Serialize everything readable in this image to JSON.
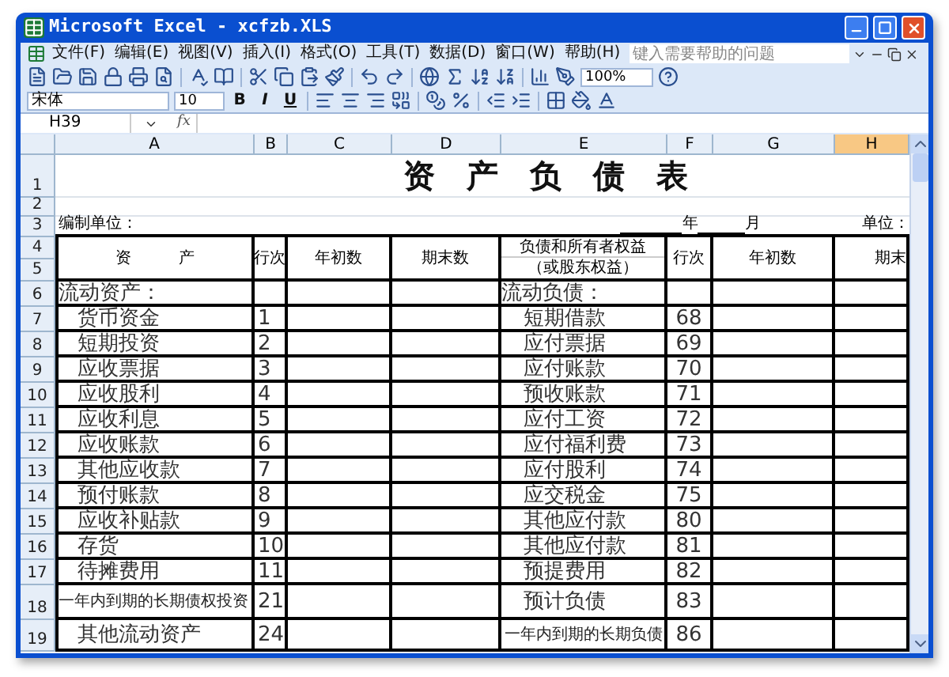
{
  "window": {
    "title": "Microsoft Excel - xcfzb.XLS"
  },
  "menu": [
    {
      "label": "文件(F)"
    },
    {
      "label": "编辑(E)"
    },
    {
      "label": "视图(V)"
    },
    {
      "label": "插入(I)"
    },
    {
      "label": "格式(O)"
    },
    {
      "label": "工具(T)"
    },
    {
      "label": "数据(D)"
    },
    {
      "label": "窗口(W)"
    },
    {
      "label": "帮助(H)"
    }
  ],
  "help_box": {
    "placeholder": "键入需要帮助的问题"
  },
  "standard_toolbar": {
    "zoom": "100%"
  },
  "format_toolbar": {
    "font": "宋体",
    "size": "10",
    "style_buttons": [
      "B",
      "I",
      "U"
    ]
  },
  "formula_bar": {
    "name_box": "H39",
    "fx": "fx"
  },
  "columns": [
    {
      "label": "A",
      "selected": false
    },
    {
      "label": "B",
      "selected": false
    },
    {
      "label": "C",
      "selected": false
    },
    {
      "label": "D",
      "selected": false
    },
    {
      "label": "E",
      "selected": false
    },
    {
      "label": "F",
      "selected": false
    },
    {
      "label": "G",
      "selected": false
    },
    {
      "label": "H",
      "selected": true
    }
  ],
  "row_numbers": [
    "1",
    "2",
    "3",
    "4",
    "5",
    "6",
    "7",
    "8",
    "9",
    "10",
    "11",
    "12",
    "13",
    "14",
    "15",
    "16",
    "17",
    "18",
    "19"
  ],
  "sheet": {
    "title": "资　产　负　债　表",
    "company_label": "编制单位：",
    "year": "年",
    "month": "月",
    "unit_label": "单位：",
    "headers": {
      "assets": "资　　　产",
      "line": "行次",
      "opening": "年初数",
      "closing": "期末数",
      "liabilities": "负债和所有者权益",
      "liabilities_sub": "（或股东权益）",
      "line_2": "行次",
      "opening_2": "年初数",
      "closing_2": "期末"
    },
    "section": {
      "assets": "流动资产：",
      "liabilities": "流动负债："
    },
    "rows": [
      {
        "asset": {
          "name": "货币资金",
          "line": "1",
          "kind": "normal"
        },
        "liability": {
          "name": "短期借款",
          "line": "68",
          "kind": "normal"
        }
      },
      {
        "asset": {
          "name": "短期投资",
          "line": "2",
          "kind": "normal"
        },
        "liability": {
          "name": "应付票据",
          "line": "69",
          "kind": "normal"
        }
      },
      {
        "asset": {
          "name": "应收票据",
          "line": "3",
          "kind": "normal"
        },
        "liability": {
          "name": "应付账款",
          "line": "70",
          "kind": "normal"
        }
      },
      {
        "asset": {
          "name": "应收股利",
          "line": "4",
          "kind": "normal"
        },
        "liability": {
          "name": "预收账款",
          "line": "71",
          "kind": "normal"
        }
      },
      {
        "asset": {
          "name": "应收利息",
          "line": "5",
          "kind": "normal"
        },
        "liability": {
          "name": "应付工资",
          "line": "72",
          "kind": "normal"
        }
      },
      {
        "asset": {
          "name": "应收账款",
          "line": "6",
          "kind": "normal"
        },
        "liability": {
          "name": "应付福利费",
          "line": "73",
          "kind": "normal"
        }
      },
      {
        "asset": {
          "name": "其他应收款",
          "line": "7",
          "kind": "normal"
        },
        "liability": {
          "name": "应付股利",
          "line": "74",
          "kind": "normal"
        }
      },
      {
        "asset": {
          "name": "预付账款",
          "line": "8",
          "kind": "normal"
        },
        "liability": {
          "name": "应交税金",
          "line": "75",
          "kind": "normal"
        }
      },
      {
        "asset": {
          "name": "应收补贴款",
          "line": "9",
          "kind": "normal"
        },
        "liability": {
          "name": "其他应付款",
          "line": "80",
          "kind": "normal"
        }
      },
      {
        "asset": {
          "name": "存货",
          "line": "10",
          "kind": "normal"
        },
        "liability": {
          "name": "其他应付款",
          "line": "81",
          "kind": "normal"
        }
      },
      {
        "asset": {
          "name": "待摊费用",
          "line": "11",
          "kind": "normal"
        },
        "liability": {
          "name": "预提费用",
          "line": "82",
          "kind": "normal"
        }
      },
      {
        "asset": {
          "name": "一年内到期的长期债权投资",
          "line": "21",
          "kind": "small"
        },
        "liability": {
          "name": "预计负债",
          "line": "83",
          "kind": "normal"
        }
      },
      {
        "asset": {
          "name": "其他流动资产",
          "line": "24",
          "kind": "normal"
        },
        "liability": {
          "name": "一年内到期的长期负债",
          "line": "86",
          "kind": "small"
        }
      }
    ]
  }
}
